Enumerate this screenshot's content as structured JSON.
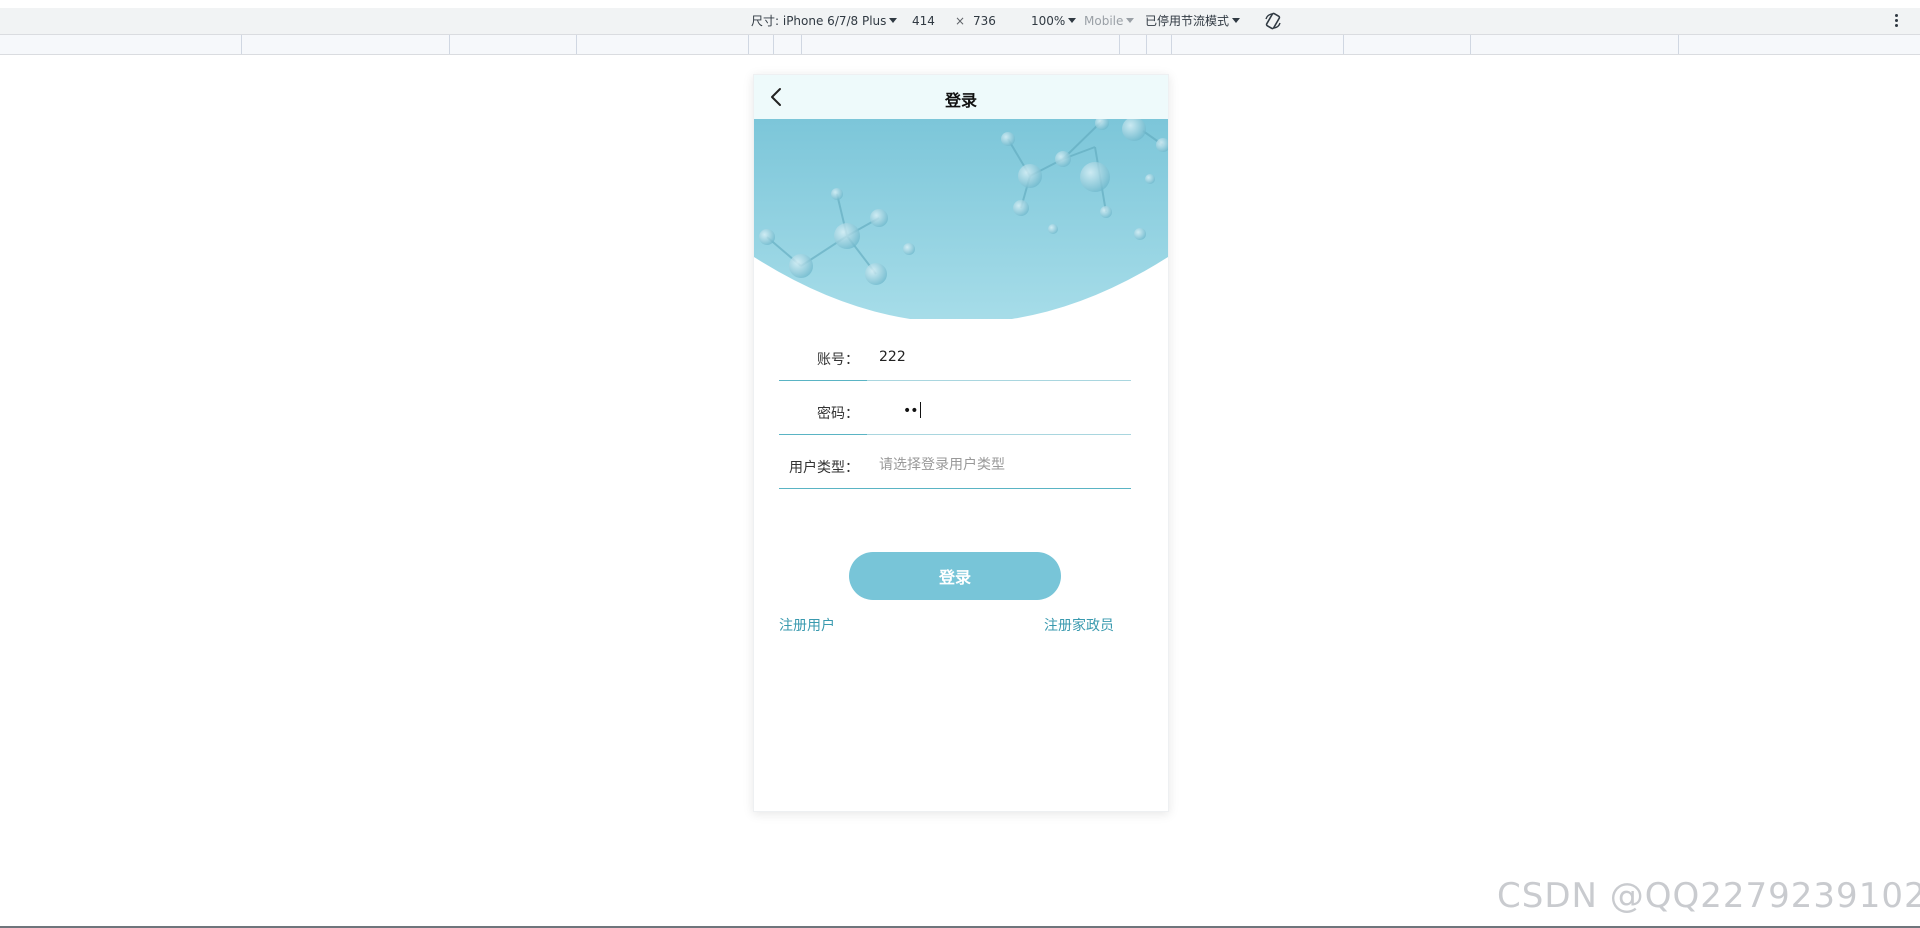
{
  "devtools": {
    "device_label": "尺寸: iPhone 6/7/8 Plus",
    "width": "414",
    "times": "×",
    "height": "736",
    "zoom": "100%",
    "ua_mode": "Mobile",
    "throttle": "已停用节流模式",
    "rotate_icon": "rotate-icon",
    "menu_icon": "kebab-menu-icon"
  },
  "app": {
    "nav_title": "登录",
    "back_icon": "chevron-left-icon",
    "form": {
      "account_label": "账号：",
      "account_value": "222",
      "password_label": "密码：",
      "password_mask": "••",
      "usertype_label": "用户类型：",
      "usertype_placeholder": "请选择登录用户类型"
    },
    "login_button": "登录",
    "register_user_link": "注册用户",
    "register_worker_link": "注册家政员"
  },
  "watermark": "CSDN @QQ2279239102",
  "colors": {
    "accent": "#78c5d8",
    "link": "#3a9aaf",
    "nav_bg": "#eefafb"
  }
}
